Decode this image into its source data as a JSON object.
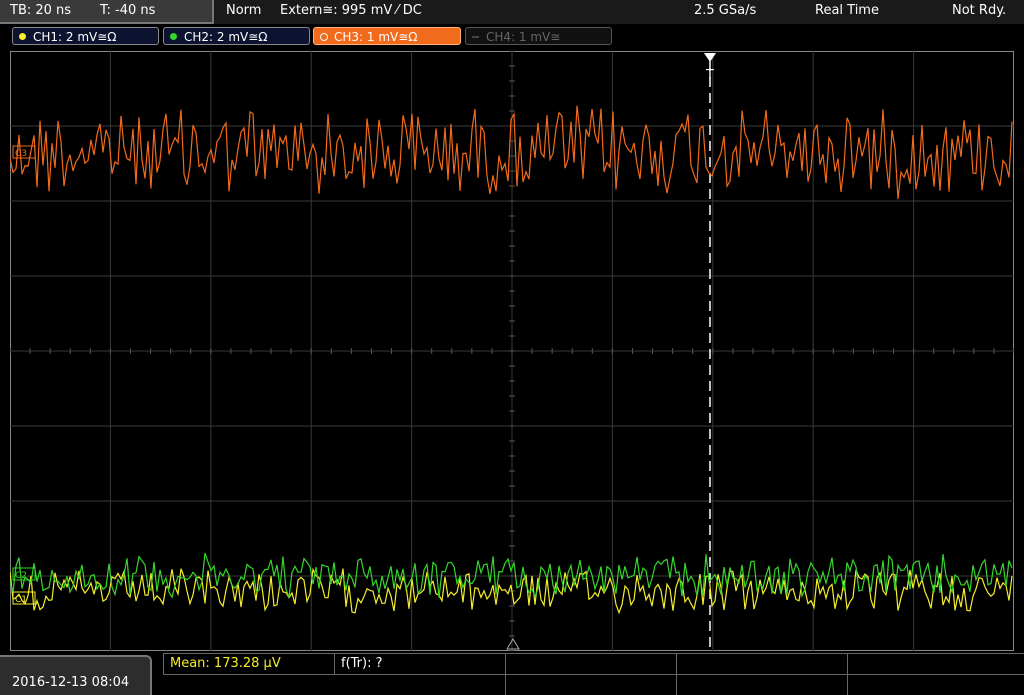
{
  "status": {
    "timebase": "TB: 20 ns",
    "trigger_time": "T: -40 ns",
    "mode": "Norm",
    "trigger_source": "Extern≅: 995 mV ⁄ DC",
    "sample_rate": "2.5 GSa/s",
    "acq_mode": "Real Time",
    "state": "Not Rdy."
  },
  "channels": [
    {
      "label": "CH1: 2 mV≅Ω",
      "color": "#f5ee2a",
      "state": "on"
    },
    {
      "label": "CH2: 2 mV≅Ω",
      "color": "#35d62a",
      "state": "on"
    },
    {
      "label": "CH3: 1 mV≅Ω",
      "color": "#f26a1b",
      "state": "active"
    },
    {
      "label": "CH4: 1 mV≅",
      "color": "#555555",
      "state": "off"
    }
  ],
  "markers": {
    "trigger": "T",
    "ch3_marker": "C3",
    "ch2_marker": "C2",
    "ch1_marker": "C1"
  },
  "measurements": {
    "mean": "Mean: 173.28 µV",
    "freq": "f(Tr): ?"
  },
  "datetime": "2016-12-13 08:04",
  "colors": {
    "ch1": "#f5ee2a",
    "ch2": "#35d62a",
    "ch3": "#f26a1b",
    "grid": "#3a3a3a"
  }
}
